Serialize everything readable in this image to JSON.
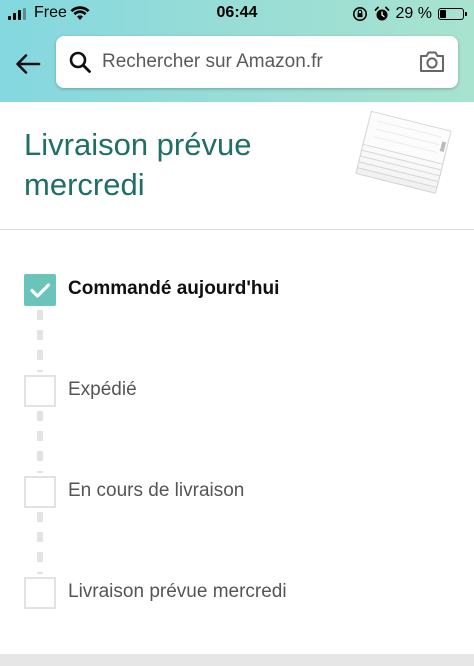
{
  "status_bar": {
    "carrier": "Free",
    "time": "06:44",
    "battery": "29 %",
    "battery_level": 0.29
  },
  "search": {
    "placeholder": "Rechercher sur Amazon.fr"
  },
  "delivery": {
    "title": "Livraison prévue mercredi"
  },
  "tracker": {
    "steps": [
      {
        "label": "Commandé aujourd'hui",
        "completed": true
      },
      {
        "label": "Expédié",
        "completed": false
      },
      {
        "label": "En cours de livraison",
        "completed": false
      },
      {
        "label": "Livraison prévue mercredi",
        "completed": false
      }
    ]
  },
  "colors": {
    "header_gradient_start": "#84d8e0",
    "header_gradient_end": "#a8e3cf",
    "title_teal": "#1f6f67",
    "check_teal": "#6bc4b9"
  },
  "icons": {
    "back": "back-arrow-icon",
    "search": "search-icon",
    "camera": "camera-icon",
    "check": "check-icon"
  }
}
